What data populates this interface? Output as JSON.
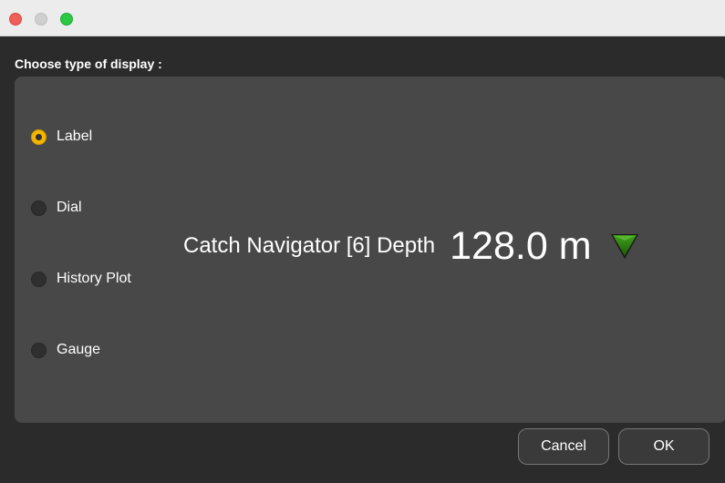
{
  "window": {
    "controls": [
      "close",
      "minimize",
      "maximize"
    ]
  },
  "dialog": {
    "heading": "Choose type of display :",
    "options": [
      {
        "label": "Label",
        "selected": true
      },
      {
        "label": "Dial",
        "selected": false
      },
      {
        "label": "History Plot",
        "selected": false
      },
      {
        "label": "Gauge",
        "selected": false
      }
    ],
    "preview": {
      "name": "Catch Navigator [6] Depth",
      "value": "128.0 m",
      "trend_icon": "triangle-down-icon",
      "trend_color": "#2e8b14"
    },
    "buttons": {
      "cancel": "Cancel",
      "ok": "OK"
    }
  },
  "colors": {
    "accent": "#f4b400",
    "panel": "#484848",
    "background": "#2b2b2b"
  }
}
